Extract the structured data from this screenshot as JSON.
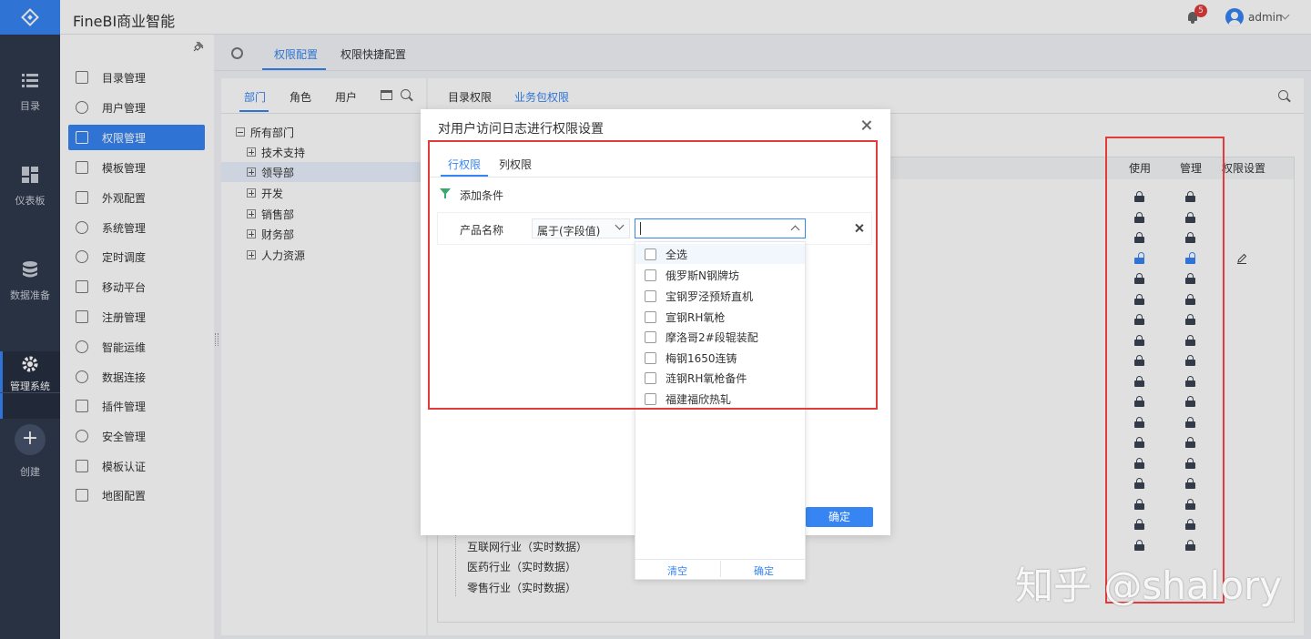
{
  "app": {
    "title": "FineBI商业智能",
    "notification_count": "5",
    "user": "admin"
  },
  "leftnav": [
    {
      "label": "目录",
      "icon": "list-icon"
    },
    {
      "label": "仪表板",
      "icon": "dashboard-icon"
    },
    {
      "label": "数据准备",
      "icon": "database-icon"
    },
    {
      "label": "管理系统",
      "icon": "gear-icon"
    }
  ],
  "create": {
    "label": "创建",
    "icon": "plus-icon"
  },
  "menu": [
    "目录管理",
    "用户管理",
    "权限管理",
    "模板管理",
    "外观配置",
    "系统管理",
    "定时调度",
    "移动平台",
    "注册管理",
    "智能运维",
    "数据连接",
    "插件管理",
    "安全管理",
    "模板认证",
    "地图配置"
  ],
  "top_tabs": [
    "权限配置",
    "权限快捷配置"
  ],
  "left_panel": {
    "tabs": [
      "部门",
      "角色",
      "用户"
    ],
    "tree": [
      "所有部门",
      "技术支持",
      "领导部",
      "开发",
      "销售部",
      "财务部",
      "人力资源"
    ]
  },
  "right_panel": {
    "tabs": [
      "目录权限",
      "业务包权限"
    ],
    "columns": [
      "使用",
      "管理",
      "权限设置"
    ],
    "visible_items": [
      "互联网行业（实时数据）",
      "医药行业（实时数据）",
      "零售行业（实时数据）"
    ]
  },
  "modal": {
    "title": "对用户访问日志进行权限设置",
    "tabs": [
      "行权限",
      "列权限"
    ],
    "add_condition": "添加条件",
    "field_name": "产品名称",
    "operator": "属于(字段值)",
    "ok_label": "确定"
  },
  "dropdown": {
    "items": [
      "全选",
      "俄罗斯N钢牌坊",
      "宝钢罗泾预矫直机",
      "宣钢RH氧枪",
      "摩洛哥2#段辊装配",
      "梅钢1650连铸",
      "涟钢RH氧枪备件",
      "福建福欣热轧"
    ],
    "clear_label": "清空",
    "ok_label": "确定"
  },
  "watermark": "知乎 @shalory",
  "colors": {
    "accent": "#3685f2",
    "nav_bg": "#2f3a4d",
    "annotation": "#e23b3b"
  }
}
